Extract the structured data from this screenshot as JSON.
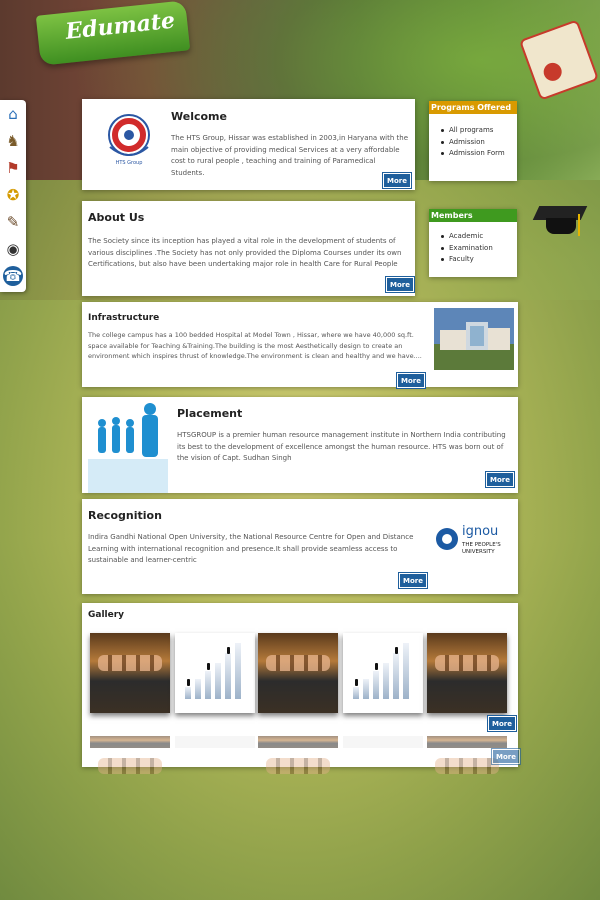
{
  "brand": {
    "name": "Edumate"
  },
  "side_icons": [
    "home-icon",
    "horse-icon",
    "running-icon",
    "award-icon",
    "clipboard-icon",
    "camera-icon",
    "phone-icon"
  ],
  "welcome": {
    "title": "Welcome",
    "logo_caption": "HTS Group",
    "text": "The HTS Group, Hissar was established in 2003,in Haryana with the main objective of providing medical Services at a very affordable cost to rural people , teaching and training of Paramedical Students.",
    "more": "More"
  },
  "about": {
    "title": "About Us",
    "text": "The Society since its inception has played a vital role in the development of students of various disciplines .The Society has not only provided the Diploma Courses under its own Certifications, but also have been undertaking major role in health Care for Rural People",
    "more": "More"
  },
  "programs": {
    "title": "Programs Offered",
    "color": "#d99a00",
    "items": [
      "All programs",
      "Admission",
      "Admission Form"
    ]
  },
  "members": {
    "title": "Members",
    "color": "#3f9a1f",
    "items": [
      "Academic",
      "Examination",
      "Faculty"
    ]
  },
  "infrastructure": {
    "title": "Infrastructure",
    "text": "The college campus has a 100 bedded Hospital at Model Town , Hissar, where we have 40,000 sq.ft. space available for Teaching &Training.The building is the most Aesthetically design to create an environment which inspires thrust of knowledge.The environment is clean and healthy and we have....",
    "more": "More"
  },
  "placement": {
    "title": "Placement",
    "text": "HTSGROUP is a premier human resource management institute in Northern India contributing its best to the development of excellence amongst the human resource. HTS was born out of the vision of Capt. Sudhan Singh",
    "more": "More"
  },
  "recognition": {
    "title": "Recognition",
    "text": "Indira Gandhi National Open University, the National Resource Centre for Open and Distance Learning with international recognition and presence.It shall provide seamless access to sustainable and learner-centric",
    "more": "More",
    "logo_name": "ignou",
    "logo_tagline_1": "THE PEOPLE'S",
    "logo_tagline_2": "UNIVERSITY"
  },
  "gallery": {
    "title": "Gallery",
    "more": "More",
    "more_reflect": "More"
  }
}
